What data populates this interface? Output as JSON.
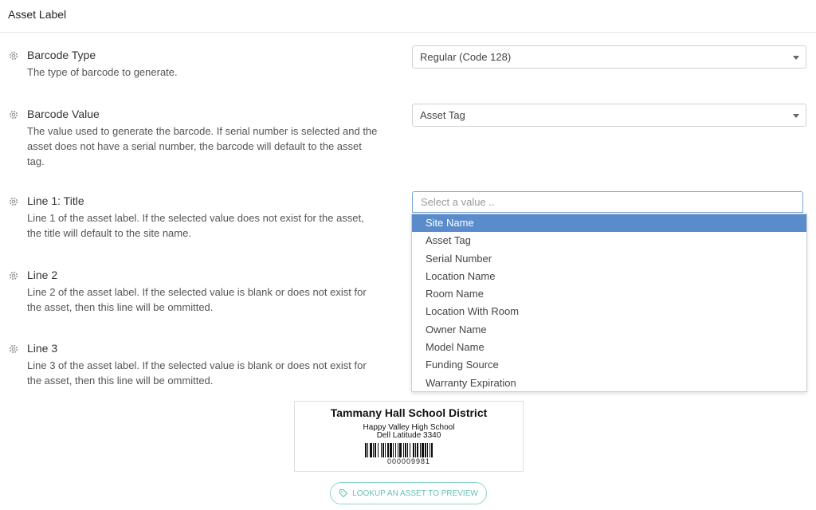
{
  "header": {
    "title": "Asset Label"
  },
  "settings": [
    {
      "title": "Barcode Type",
      "description": "The type of barcode to generate."
    },
    {
      "title": "Barcode Value",
      "description": "The value used to generate the barcode. If serial number is selected and the asset does not have a serial number, the barcode will default to the asset tag."
    },
    {
      "title": "Line 1: Title",
      "description": "Line 1 of the asset label. If the selected value does not exist for the asset, the title will default to the site name."
    },
    {
      "title": "Line 2",
      "description": "Line 2 of the asset label. If the selected value is blank or does not exist for the asset, then this line will be ommitted."
    },
    {
      "title": "Line 3",
      "description": "Line 3 of the asset label. If the selected value is blank or does not exist for the asset, then this line will be ommitted."
    }
  ],
  "selects": {
    "barcode_type": "Regular (Code 128)",
    "barcode_value": "Asset Tag",
    "search_placeholder": "Select a value .."
  },
  "dropdown": {
    "options": [
      "Site Name",
      "Asset Tag",
      "Serial Number",
      "Location Name",
      "Room Name",
      "Location With Room",
      "Owner Name",
      "Model Name",
      "Funding Source",
      "Warranty Expiration"
    ],
    "highlighted": "Site Name"
  },
  "preview": {
    "title": "Tammany Hall School District",
    "line2": "Happy Valley High School",
    "line3": "Dell Latitude 3340",
    "barcode_number": "000009981"
  },
  "lookup_button": {
    "label": "LOOKUP AN ASSET TO PREVIEW"
  },
  "colors": {
    "highlight": "#5a8ccc",
    "accent": "#67c1b8"
  },
  "icons": {
    "setting": "gear-icon",
    "lookup": "tag-icon",
    "caret": "chevron-down-icon"
  }
}
